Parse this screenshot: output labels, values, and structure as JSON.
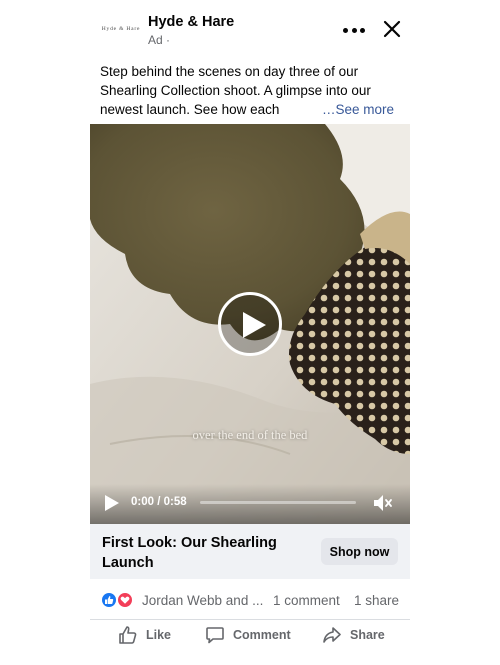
{
  "post": {
    "brand_name": "Hyde & Hare",
    "logo_text": "Hyde & Hare",
    "sponsored_label": "Ad ·",
    "caption_lines": [
      "Step behind the scenes on day three of our",
      "Shearling Collection shoot. A glimpse into our",
      "newest launch. See how each"
    ],
    "see_more": "…See more"
  },
  "video": {
    "subtitle": "over the end of the bed",
    "time": "0:00 / 0:58",
    "progress": 0
  },
  "cta": {
    "title": "First Look: Our Shearling Launch",
    "button": "Shop now"
  },
  "engagement": {
    "reactor_names": "Jordan Webb and ...",
    "comments": "1 comment",
    "shares": "1 share"
  },
  "actions": {
    "like": "Like",
    "comment": "Comment",
    "share": "Share"
  },
  "icons": [
    "more-icon",
    "close-icon",
    "play-icon",
    "mute-icon",
    "like-reaction-icon",
    "love-reaction-icon",
    "thumbs-up-icon",
    "comment-icon",
    "share-icon"
  ],
  "colors": {
    "link": "#385898",
    "secondary_text": "#65676b",
    "cta_background": "#f0f2f5",
    "button_background": "#e4e6eb",
    "like_blue": "#1877f2",
    "love_red": "#f33e58"
  }
}
